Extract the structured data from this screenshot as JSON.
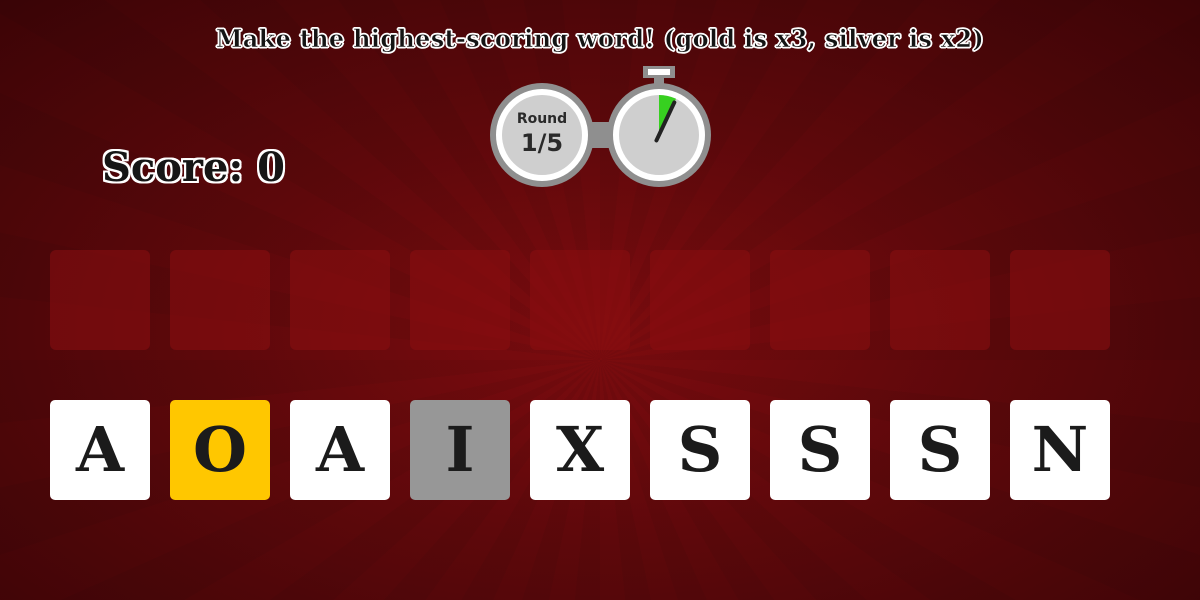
{
  "header": {
    "instructions": "Make the highest-scoring word! (gold is x3, silver is x2)"
  },
  "score": {
    "text": "Score: 0"
  },
  "round": {
    "label": "Round",
    "value": "1/5"
  },
  "timer": {
    "elapsed_fraction": 0.07,
    "elapsed_color": "#37d020",
    "face_color": "#cfcfcf",
    "frame_color": "#8f8f8f"
  },
  "answer_slots": [
    {
      "letter": ""
    },
    {
      "letter": ""
    },
    {
      "letter": ""
    },
    {
      "letter": ""
    },
    {
      "letter": ""
    },
    {
      "letter": ""
    },
    {
      "letter": ""
    },
    {
      "letter": ""
    },
    {
      "letter": ""
    }
  ],
  "tiles": [
    {
      "letter": "A",
      "type": "normal"
    },
    {
      "letter": "O",
      "type": "gold"
    },
    {
      "letter": "A",
      "type": "normal"
    },
    {
      "letter": "I",
      "type": "silver"
    },
    {
      "letter": "X",
      "type": "normal"
    },
    {
      "letter": "S",
      "type": "normal"
    },
    {
      "letter": "S",
      "type": "normal"
    },
    {
      "letter": "S",
      "type": "normal"
    },
    {
      "letter": "N",
      "type": "normal"
    }
  ],
  "colors": {
    "background": "#6e0a0d",
    "gold": "#ffc700",
    "silver": "#979797",
    "tile": "#ffffff"
  }
}
